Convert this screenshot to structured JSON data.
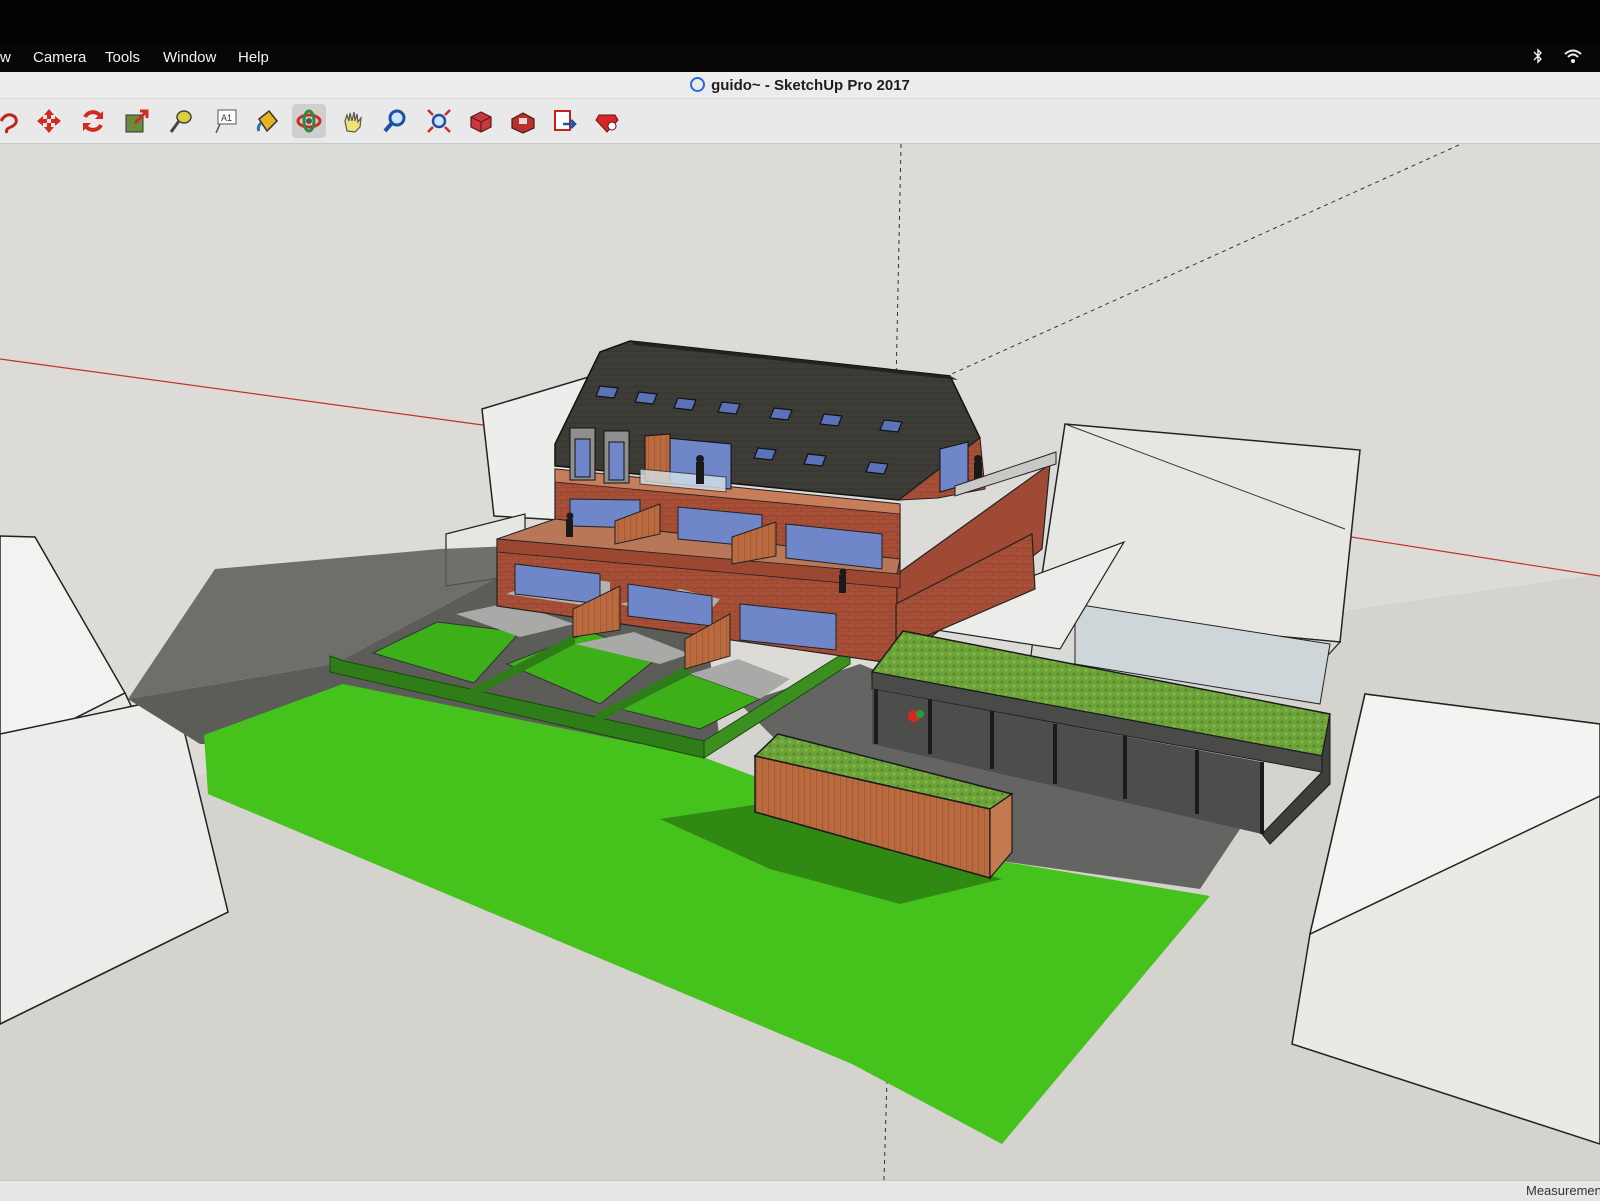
{
  "menu": {
    "items": [
      {
        "label": "w"
      },
      {
        "label": "Camera"
      },
      {
        "label": "Tools"
      },
      {
        "label": "Window"
      },
      {
        "label": "Help"
      }
    ]
  },
  "window": {
    "title": "guido~ - SketchUp Pro 2017"
  },
  "toolbar": {
    "tools": [
      {
        "icon": "lasso-select-icon"
      },
      {
        "icon": "move-icon"
      },
      {
        "icon": "rotate-icon"
      },
      {
        "icon": "scale-icon"
      },
      {
        "icon": "tape-measure-icon"
      },
      {
        "icon": "text-icon",
        "text": "A1"
      },
      {
        "icon": "paint-bucket-icon"
      },
      {
        "icon": "orbit-icon",
        "active": true
      },
      {
        "icon": "pan-icon"
      },
      {
        "icon": "zoom-icon"
      },
      {
        "icon": "zoom-extents-icon"
      },
      {
        "icon": "3d-warehouse-icon"
      },
      {
        "icon": "extension-warehouse-icon"
      },
      {
        "icon": "layout-send-icon"
      },
      {
        "icon": "extension-manager-icon"
      }
    ]
  },
  "status": {
    "measurements_label": "Measurements"
  },
  "colors": {
    "brick": "#a5503a",
    "roof": "#3b3a36",
    "lawn": "#45c21b",
    "sky": "#dcdbd7",
    "red_axis": "#c8302a",
    "glass": "#6f86c9",
    "timber": "#b8683e"
  }
}
